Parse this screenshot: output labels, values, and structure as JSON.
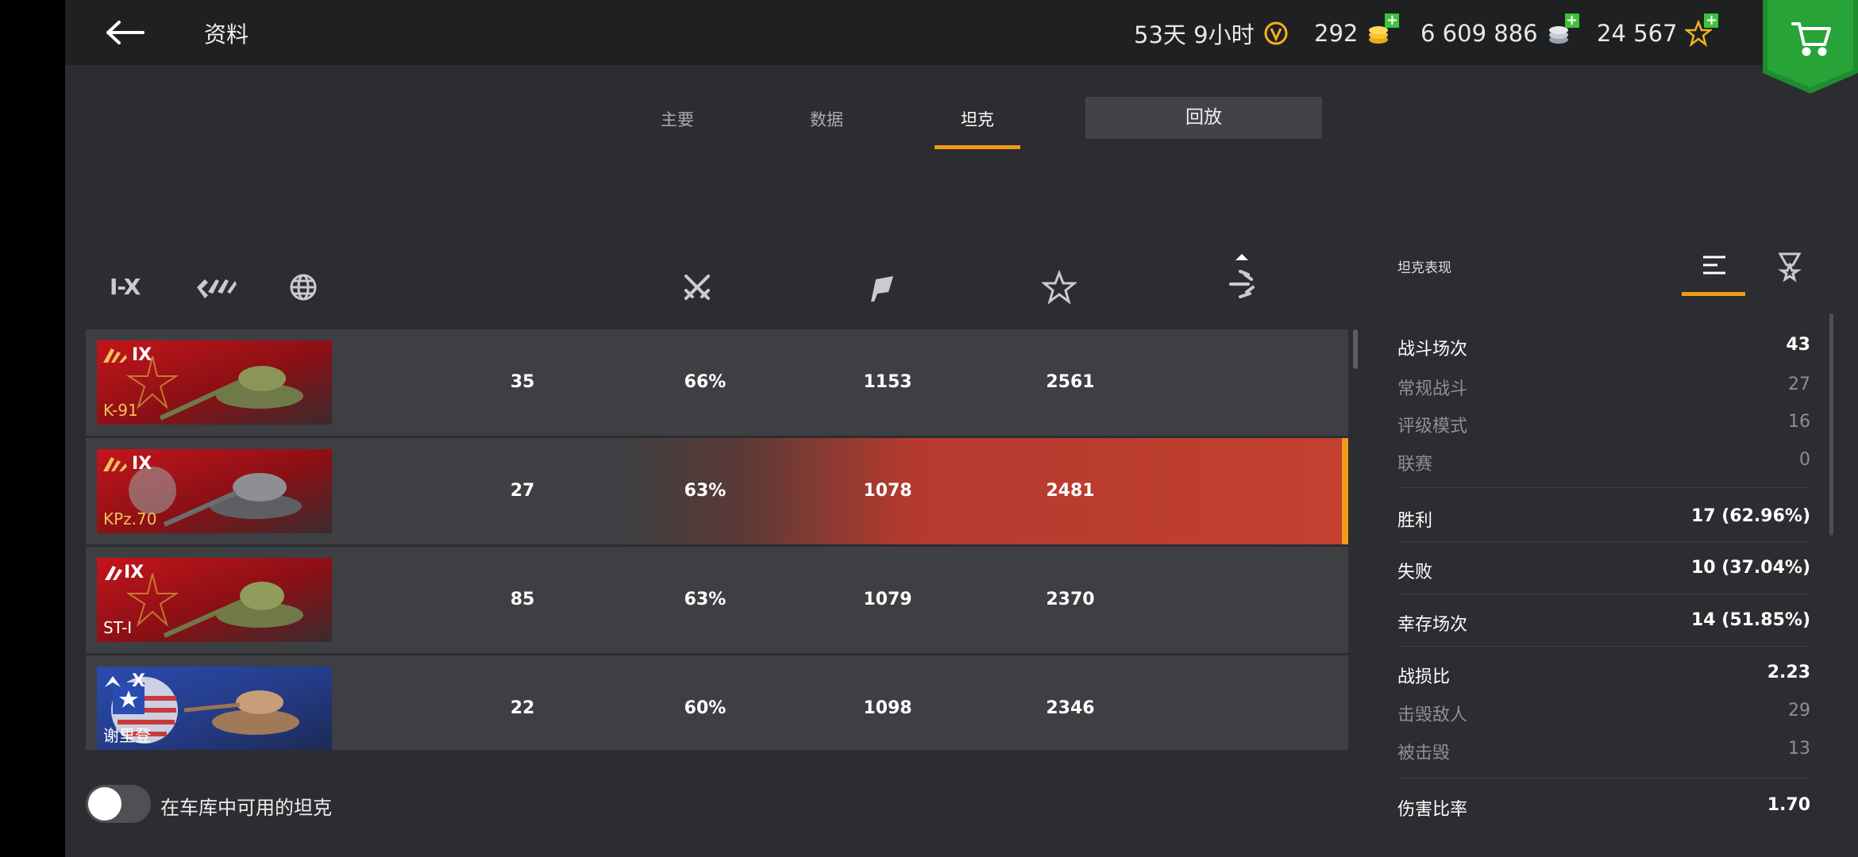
{
  "header": {
    "title": "资料",
    "premium_time": "53天 9小时",
    "gold": "292",
    "credits": "6 609 886",
    "free_xp": "24 567",
    "colors": {
      "gold": "#f2b21c",
      "plus": "#3cc33c",
      "shop": "#1f8c2e"
    }
  },
  "tabs": [
    {
      "label": "主要"
    },
    {
      "label": "数据"
    },
    {
      "label": "坦克"
    },
    {
      "label": "回放"
    }
  ],
  "active_tab": "坦克",
  "filters": {
    "tier_label": "I-X"
  },
  "columns": [
    "battles-icon",
    "win-rate-icon",
    "experience-icon",
    "damage-icon"
  ],
  "tanks": [
    {
      "name": "K-91",
      "tier": "IX",
      "nation_color": "red",
      "battles": "35",
      "win_rate": "66%",
      "avg_exp": "1153",
      "avg_damage": "2561",
      "selected": false
    },
    {
      "name": "KPz.70",
      "tier": "IX",
      "nation_color": "red",
      "battles": "27",
      "win_rate": "63%",
      "avg_exp": "1078",
      "avg_damage": "2481",
      "selected": true
    },
    {
      "name": "ST-I",
      "tier": "IX",
      "nation_color": "red",
      "battles": "85",
      "win_rate": "63%",
      "avg_exp": "1079",
      "avg_damage": "2370",
      "selected": false
    },
    {
      "name": "谢里登",
      "tier": "X",
      "nation_color": "blue",
      "battles": "22",
      "win_rate": "60%",
      "avg_exp": "1098",
      "avg_damage": "2346",
      "selected": false
    }
  ],
  "toggle": {
    "label": "在车库中可用的坦克",
    "on": false
  },
  "panel": {
    "title": "坦克表现",
    "stats": [
      {
        "label": "战斗场次",
        "value": "43",
        "kind": "main"
      },
      {
        "label": "常规战斗",
        "value": "27",
        "kind": "sub"
      },
      {
        "label": "评级模式",
        "value": "16",
        "kind": "sub"
      },
      {
        "label": "联赛",
        "value": "0",
        "kind": "sub"
      },
      {
        "label": "胜利",
        "value": "17 (62.96%)",
        "kind": "main"
      },
      {
        "label": "失败",
        "value": "10 (37.04%)",
        "kind": "main"
      },
      {
        "label": "幸存场次",
        "value": "14 (51.85%)",
        "kind": "main"
      },
      {
        "label": "战损比",
        "value": "2.23",
        "kind": "main"
      },
      {
        "label": "击毁敌人",
        "value": "29",
        "kind": "sub"
      },
      {
        "label": "被击毁",
        "value": "13",
        "kind": "sub"
      },
      {
        "label": "伤害比率",
        "value": "1.70",
        "kind": "main"
      }
    ]
  }
}
